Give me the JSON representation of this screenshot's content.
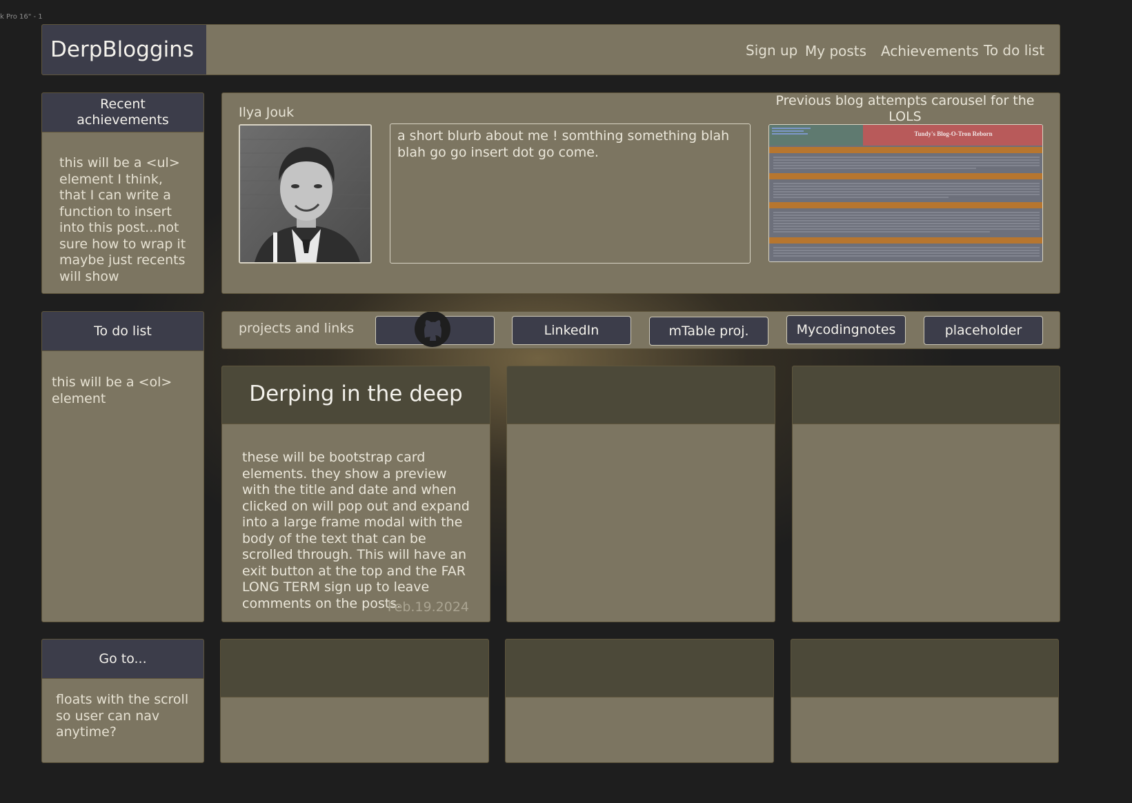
{
  "frame_label": "k Pro 16\" - 1",
  "nav": {
    "brand": "DerpBloggins",
    "links": [
      "Sign up",
      "My posts",
      "Achievements",
      "To do list"
    ]
  },
  "sidebar": {
    "achievements": {
      "title": "Recent achievements",
      "body": "this will be a <ul> element I think, that I can write a function to insert into this post...not sure how to wrap it maybe just recents will show"
    },
    "todo": {
      "title": "To do list",
      "body": "this will be a <ol> element"
    },
    "goto": {
      "title": "Go to...",
      "body": "floats with the scroll so user can nav anytime?"
    }
  },
  "profile": {
    "name": "Ilya Jouk",
    "blurb": "a short blurb about me ! somthing something blah blah go go insert dot go come.",
    "carousel_title": "Previous blog attempts carousel for the LOLS",
    "carousel_banner": "Tundy's Blog-O-Tron Reborn"
  },
  "projects": {
    "label": "projects and links",
    "buttons": [
      "",
      "LinkedIn",
      "mTable proj.",
      "Mycodingnotes",
      "placeholder"
    ]
  },
  "cards": [
    {
      "title": "Derping in the deep",
      "body": "these will be bootstrap card elements. they show a preview with the title and date and when clicked on will pop out and expand into a large frame modal with the body of the text that can be scrolled through. This will have an exit button at the top and the FAR LONG TERM sign up to leave comments on the posts.",
      "date": "Feb.19.2024"
    }
  ],
  "colors": {
    "page_bg": "#1e1e1e",
    "panel": "#7c7561",
    "panel_dark": "#3c3d4a",
    "card_head": "#4c4939"
  }
}
